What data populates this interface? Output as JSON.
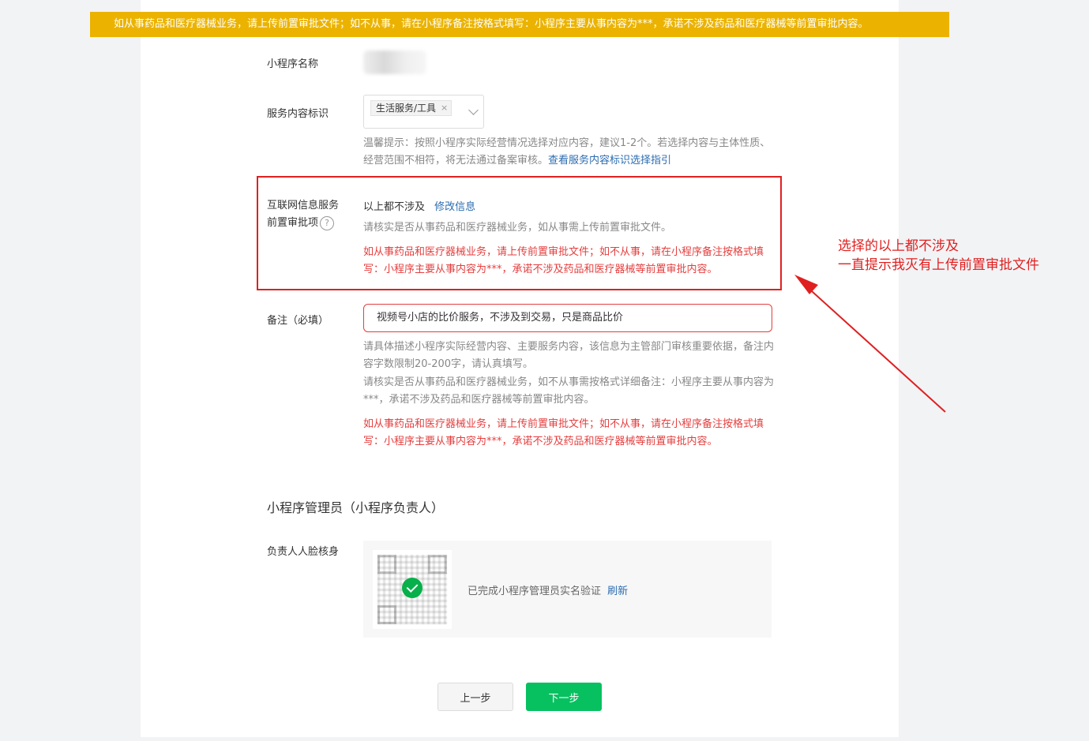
{
  "banner": {
    "text": "如从事药品和医疗器械业务，请上传前置审批文件；如不从事，请在小程序备注按格式填写：小程序主要从事内容为***，承诺不涉及药品和医疗器械等前置审批内容。"
  },
  "name_field": {
    "label": "小程序名称"
  },
  "service_field": {
    "label": "服务内容标识",
    "selected_tag": "生活服务/工具",
    "tag_remove": "×",
    "tip": "温馨提示：按照小程序实际经营情况选择对应内容，建议1-2个。若选择内容与主体性质、经营范围不相符，将无法通过备案审核。",
    "tip_link": "查看服务内容标识选择指引"
  },
  "approval_field": {
    "label_line1": "互联网信息服务",
    "label_line2": "前置审批项",
    "help": "?",
    "value": "以上都不涉及",
    "edit_link": "修改信息",
    "tip": "请核实是否从事药品和医疗器械业务，如从事需上传前置审批文件。",
    "error": "如从事药品和医疗器械业务，请上传前置审批文件；如不从事，请在小程序备注按格式填写：小程序主要从事内容为***，承诺不涉及药品和医疗器械等前置审批内容。"
  },
  "remark_field": {
    "label": "备注（必填）",
    "value": "视频号小店的比价服务，不涉及到交易，只是商品比价",
    "tip": "请具体描述小程序实际经营内容、主要服务内容，该信息为主管部门审核重要依据，备注内容字数限制20-200字，请认真填写。",
    "tip2": "请核实是否从事药品和医疗器械业务，如不从事需按格式详细备注：小程序主要从事内容为***，承诺不涉及药品和医疗器械等前置审批内容。",
    "error": "如从事药品和医疗器械业务，请上传前置审批文件；如不从事，请在小程序备注按格式填写：小程序主要从事内容为***，承诺不涉及药品和医疗器械等前置审批内容。"
  },
  "admin_section": {
    "title": "小程序管理员（小程序负责人）",
    "face_label": "负责人人脸核身",
    "verified_text": "已完成小程序管理员实名验证",
    "refresh_link": "刷新"
  },
  "buttons": {
    "prev": "上一步",
    "next": "下一步"
  },
  "annotation": {
    "line1": "选择的以上都不涉及",
    "line2": "一直提示我灭有上传前置审批文件"
  },
  "colors": {
    "banner": "#ebb300",
    "error": "#e53e3e",
    "primary": "#07c160",
    "annotation": "#e02020",
    "link": "#2b6cb0"
  }
}
